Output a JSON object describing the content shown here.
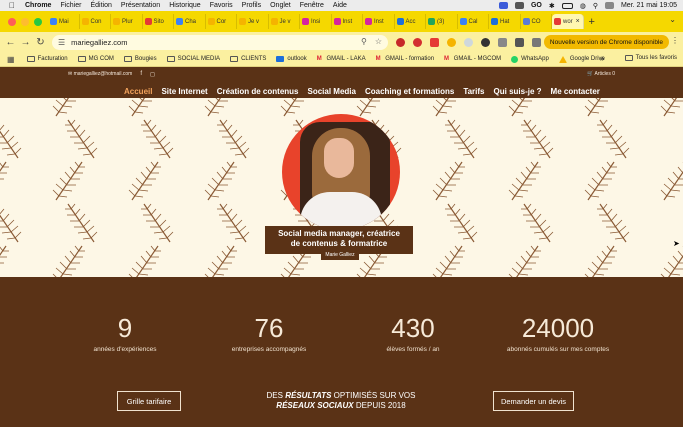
{
  "menubar": {
    "app": "Chrome",
    "items": [
      "Fichier",
      "Édition",
      "Présentation",
      "Historique",
      "Favoris",
      "Profils",
      "Onglet",
      "Fenêtre",
      "Aide"
    ],
    "clock": "Mer. 21 mai  19:05"
  },
  "tabs": [
    {
      "label": "Mai",
      "color": "#3b82f6"
    },
    {
      "label": "Con",
      "color": "#f5b400"
    },
    {
      "label": "Plur",
      "color": "#f5b400"
    },
    {
      "label": "Sito",
      "color": "#e53935"
    },
    {
      "label": "Cha",
      "color": "#3b82f6"
    },
    {
      "label": "Cor",
      "color": "#f5b400"
    },
    {
      "label": "Je v",
      "color": "#f5b400"
    },
    {
      "label": "Je v",
      "color": "#f5b400"
    },
    {
      "label": "Insi",
      "color": "#d6249f"
    },
    {
      "label": "Inst",
      "color": "#d6249f"
    },
    {
      "label": "Inst",
      "color": "#d6249f"
    },
    {
      "label": "Acc",
      "color": "#1e6fd9"
    },
    {
      "label": "(3)",
      "color": "#22a55b"
    },
    {
      "label": "Cal",
      "color": "#3b82f6"
    },
    {
      "label": "Hat",
      "color": "#1e6fd9"
    },
    {
      "label": "CO",
      "color": "#5b7bd5"
    },
    {
      "label": "wor",
      "color": "#e53935",
      "active": true
    }
  ],
  "toolbar": {
    "url": "mariegalliez.com",
    "update_label": "Nouvelle version de Chrome disponible"
  },
  "bookmarks": {
    "items": [
      "Facturation",
      "MG COM",
      "Bougies",
      "SOCIAL MEDIA",
      "CLIENTS",
      "outlook",
      "GMAIL - LAKA",
      "GMAIL - formation",
      "GMAIL - MGCOM",
      "WhatsApp",
      "Google Drive"
    ],
    "all": "Tous les favoris"
  },
  "site": {
    "email": "mariegalliez@hotmail.com",
    "cart": "Articles 0",
    "nav": [
      "Accueil",
      "Site Internet",
      "Création de contenus",
      "Social Media",
      "Coaching et formations",
      "Tarifs",
      "Qui suis-je ?",
      "Me contacter"
    ],
    "caption_line1": "Social media manager, créatrice",
    "caption_line2": "de contenus & formatrice",
    "signature": "Marie Galliez",
    "stats": [
      {
        "value": "9",
        "label": "années d'expériences"
      },
      {
        "value": "76",
        "label": "entreprises accompagnés"
      },
      {
        "value": "430",
        "label": "élèves formés / an"
      },
      {
        "value": "24000",
        "label": "abonnés cumulés sur mes comptes"
      }
    ],
    "btn_left": "Grille tarifaire",
    "btn_right": "Demander un devis",
    "tagline": {
      "p1": "DES",
      "p2": "RÉSULTATS",
      "p3": "OPTIMISÉS SUR VOS",
      "p4": "RÉSEAUX SOCIAUX",
      "p5": "DEPUIS 2018"
    }
  }
}
